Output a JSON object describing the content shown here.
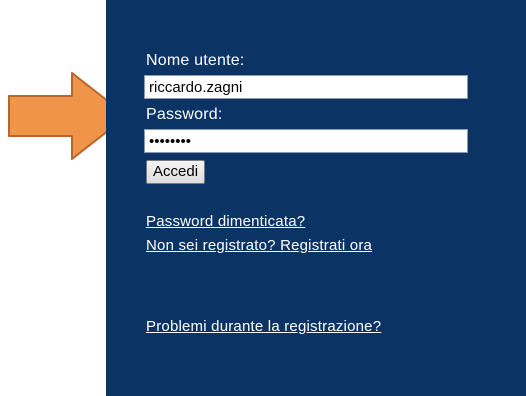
{
  "login": {
    "username_label": "Nome utente:",
    "username_value": "riccardo.zagni",
    "password_label": "Password:",
    "password_value": "••••••••",
    "submit_label": "Accedi",
    "forgot_password_link": "Password dimenticata?",
    "register_link": "Non sei registrato? Registrati ora",
    "help_link": "Problemi durante la registrazione?"
  },
  "colors": {
    "panel_background": "#0b3465",
    "arrow_fill": "#f0944a",
    "arrow_stroke": "#b8642a",
    "text": "#ffffff"
  },
  "icons": {
    "pointer": "right-arrow-icon"
  }
}
